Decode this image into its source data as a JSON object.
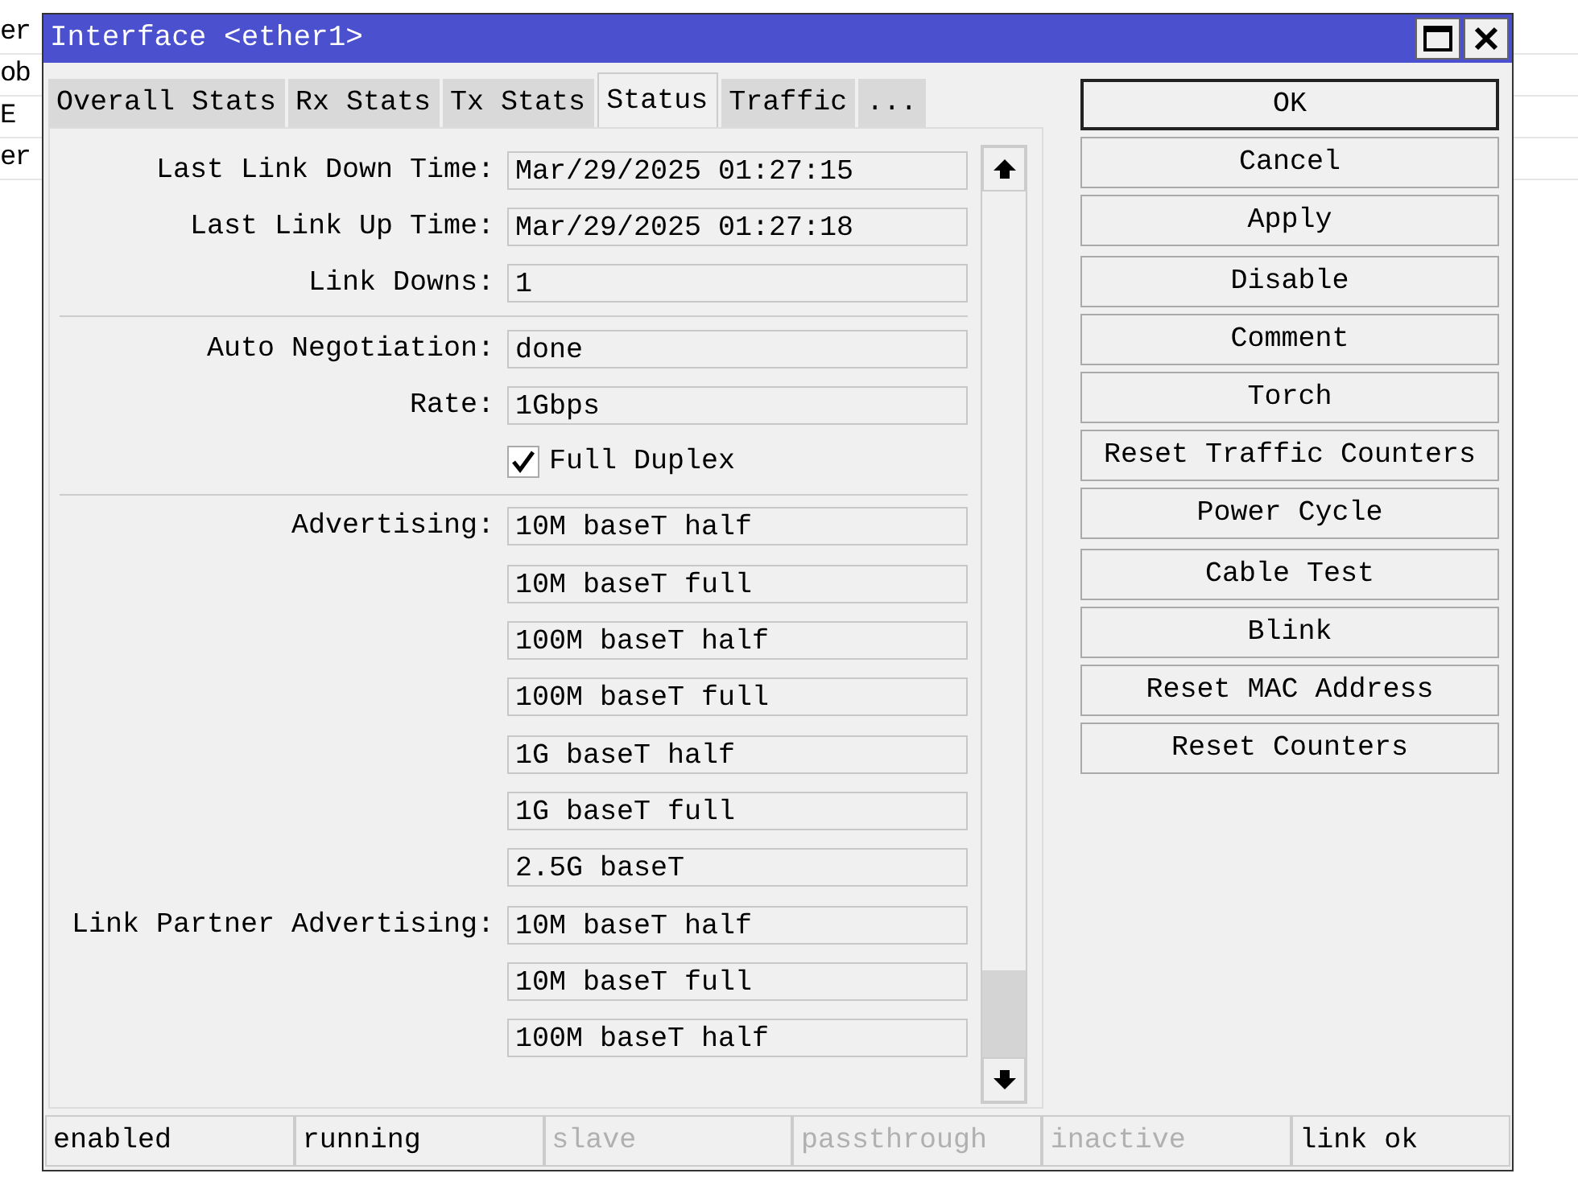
{
  "background": {
    "rows": [
      {
        "cell": "er"
      },
      {
        "cell": "ob"
      },
      {
        "cell": "E"
      },
      {
        "cell": "er"
      }
    ]
  },
  "window": {
    "title": "Interface <ether1>"
  },
  "tabs": [
    {
      "label": "Overall Stats",
      "selected": false
    },
    {
      "label": "Rx Stats",
      "selected": false
    },
    {
      "label": "Tx Stats",
      "selected": false
    },
    {
      "label": "Status",
      "selected": true
    },
    {
      "label": "Traffic",
      "selected": false
    },
    {
      "label": "...",
      "selected": false
    }
  ],
  "rows": [
    {
      "kind": "field",
      "label": "Last Link Down Time:",
      "value": "Mar/29/2025 01:27:15"
    },
    {
      "kind": "field",
      "label": "Last Link Up Time:",
      "value": "Mar/29/2025 01:27:18"
    },
    {
      "kind": "field",
      "label": "Link Downs:",
      "value": "1"
    },
    {
      "kind": "divider"
    },
    {
      "kind": "field",
      "label": "Auto Negotiation:",
      "value": "done"
    },
    {
      "kind": "field",
      "label": "Rate:",
      "value": "1Gbps"
    },
    {
      "kind": "checkbox",
      "label": "Full Duplex",
      "checked": true
    },
    {
      "kind": "divider"
    },
    {
      "kind": "field",
      "label": "Advertising:",
      "value": "10M baseT half"
    },
    {
      "kind": "field",
      "value": "10M baseT full"
    },
    {
      "kind": "field",
      "value": "100M baseT half"
    },
    {
      "kind": "field",
      "value": "100M baseT full"
    },
    {
      "kind": "field",
      "value": "1G baseT half"
    },
    {
      "kind": "field",
      "value": "1G baseT full"
    },
    {
      "kind": "field",
      "value": "2.5G baseT"
    },
    {
      "kind": "field",
      "label": "Link Partner Advertising:",
      "value": "10M baseT half"
    },
    {
      "kind": "field",
      "value": "10M baseT full"
    },
    {
      "kind": "field",
      "value": "100M baseT half"
    }
  ],
  "button_groups": [
    [
      {
        "label": "OK",
        "focused": true
      },
      {
        "label": "Cancel",
        "focused": false
      },
      {
        "label": "Apply",
        "focused": false
      }
    ],
    [
      {
        "label": "Disable",
        "focused": false
      },
      {
        "label": "Comment",
        "focused": false
      },
      {
        "label": "Torch",
        "focused": false
      },
      {
        "label": "Reset Traffic Counters",
        "focused": false
      },
      {
        "label": "Power Cycle",
        "focused": false
      }
    ],
    [
      {
        "label": "Cable Test",
        "focused": false
      },
      {
        "label": "Blink",
        "focused": false
      },
      {
        "label": "Reset MAC Address",
        "focused": false
      },
      {
        "label": "Reset Counters",
        "focused": false
      }
    ]
  ],
  "status_bar": [
    {
      "text": "enabled",
      "disabled": false
    },
    {
      "text": "running",
      "disabled": false
    },
    {
      "text": "slave",
      "disabled": true
    },
    {
      "text": "passthrough",
      "disabled": true
    },
    {
      "text": "inactive",
      "disabled": true
    },
    {
      "text": "link ok",
      "disabled": false
    }
  ]
}
